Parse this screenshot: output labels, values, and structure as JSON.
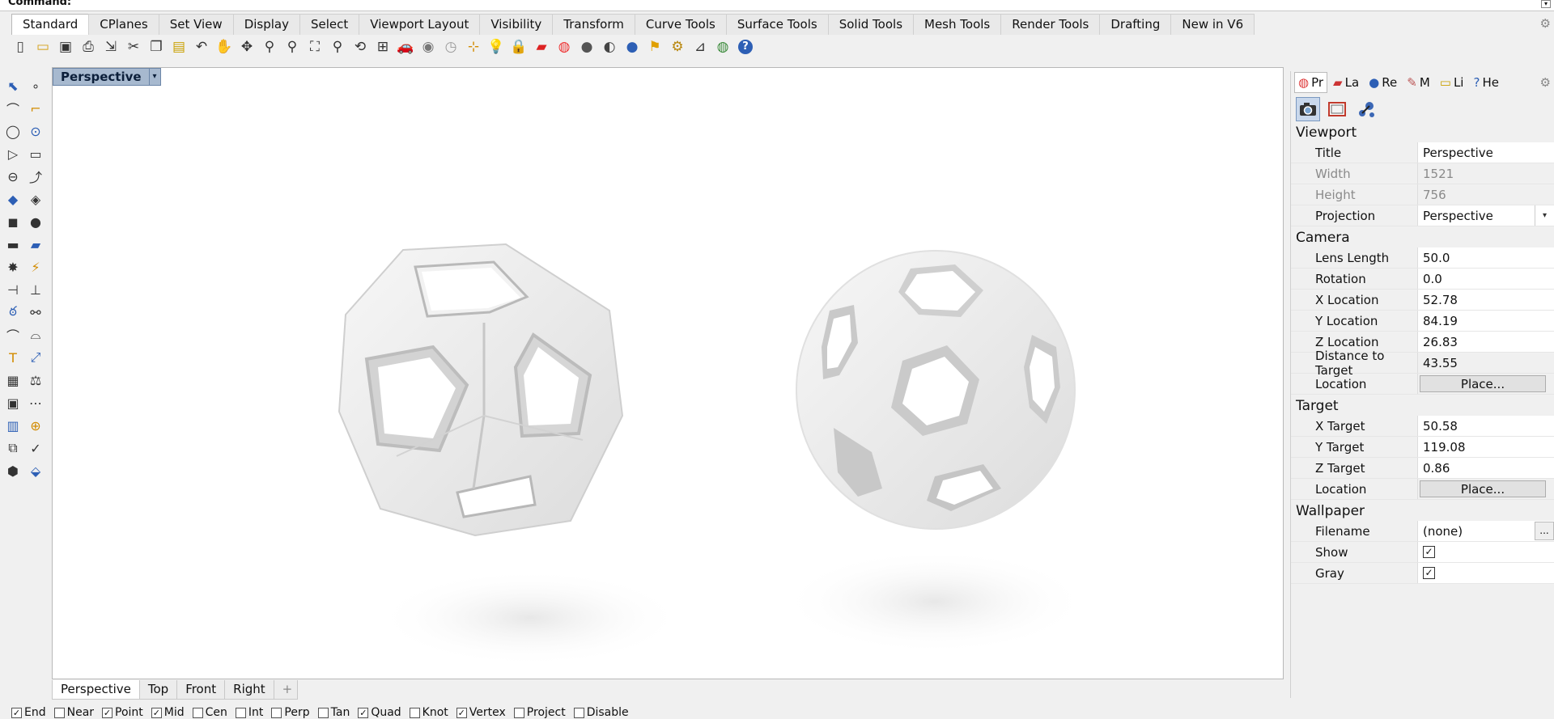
{
  "command": {
    "label": "Command:"
  },
  "tabs": [
    {
      "label": "Standard",
      "active": true
    },
    {
      "label": "CPlanes"
    },
    {
      "label": "Set View"
    },
    {
      "label": "Display"
    },
    {
      "label": "Select"
    },
    {
      "label": "Viewport Layout"
    },
    {
      "label": "Visibility"
    },
    {
      "label": "Transform"
    },
    {
      "label": "Curve Tools"
    },
    {
      "label": "Surface Tools"
    },
    {
      "label": "Solid Tools"
    },
    {
      "label": "Mesh Tools"
    },
    {
      "label": "Render Tools"
    },
    {
      "label": "Drafting"
    },
    {
      "label": "New in V6"
    }
  ],
  "toolbar_icons": [
    "new-icon",
    "open-icon",
    "save-icon",
    "print-icon",
    "import-icon",
    "cut-icon",
    "copy-icon",
    "paste-icon",
    "undo-icon",
    "pan-icon",
    "rotate-view-icon",
    "zoom-icon",
    "zoom-window-icon",
    "zoom-extents-icon",
    "zoom-selected-icon",
    "zoom-target-icon",
    "four-views-icon",
    "car-icon",
    "camera-icon",
    "clock-icon",
    "grid-snap-icon",
    "light-icon",
    "lock-icon",
    "layer-icon",
    "color-wheel-icon",
    "shaded-icon",
    "rendered-icon",
    "render-icon",
    "pointer-flag-icon",
    "settings-gears-icon",
    "dimension-icon",
    "earth-icon",
    "help-icon"
  ],
  "left_tools": [
    [
      "select-icon",
      "point-icon"
    ],
    [
      "polyline-icon",
      "curve-icon"
    ],
    [
      "circle-icon",
      "ellipse-icon"
    ],
    [
      "polygon-icon",
      "rectangle-icon"
    ],
    [
      "arc-icon",
      "fillet-icon"
    ],
    [
      "surface-icon",
      "extrude-icon"
    ],
    [
      "box-icon",
      "boolean-icon"
    ],
    [
      "cylinder-icon",
      "mesh-icon"
    ],
    [
      "explode-icon",
      "trim-icon"
    ],
    [
      "split-icon",
      "join-icon"
    ],
    [
      "group-icon",
      "block-icon"
    ],
    [
      "offset-icon",
      "blend-icon"
    ],
    [
      "text-icon",
      "scale-icon"
    ],
    [
      "array-icon",
      "mirror-icon"
    ],
    [
      "solid-box-icon",
      "dimension-tool-icon"
    ],
    [
      "grid-icon",
      "align-icon"
    ],
    [
      "analyze-icon",
      "check-icon"
    ],
    [
      "material-icon",
      "paint-icon"
    ]
  ],
  "viewport": {
    "title": "Perspective"
  },
  "viewport_tabs": [
    {
      "label": "Perspective",
      "active": true
    },
    {
      "label": "Top"
    },
    {
      "label": "Front"
    },
    {
      "label": "Right"
    },
    {
      "label": "+"
    }
  ],
  "osnap": [
    {
      "label": "End",
      "checked": true
    },
    {
      "label": "Near",
      "checked": false
    },
    {
      "label": "Point",
      "checked": true
    },
    {
      "label": "Mid",
      "checked": true
    },
    {
      "label": "Cen",
      "checked": false
    },
    {
      "label": "Int",
      "checked": false
    },
    {
      "label": "Perp",
      "checked": false
    },
    {
      "label": "Tan",
      "checked": false
    },
    {
      "label": "Quad",
      "checked": true
    },
    {
      "label": "Knot",
      "checked": false
    },
    {
      "label": "Vertex",
      "checked": true
    },
    {
      "label": "Project",
      "checked": false
    },
    {
      "label": "Disable",
      "checked": false
    }
  ],
  "panel_tabs": [
    {
      "label": "Pr",
      "icon": "properties-icon",
      "active": true
    },
    {
      "label": "La",
      "icon": "layers-icon"
    },
    {
      "label": "Re",
      "icon": "render-sphere-icon"
    },
    {
      "label": "M",
      "icon": "materials-icon"
    },
    {
      "label": "Li",
      "icon": "libraries-icon"
    },
    {
      "label": "He",
      "icon": "help-panel-icon"
    }
  ],
  "properties": {
    "viewport_section": "Viewport",
    "title_label": "Title",
    "title_value": "Perspective",
    "width_label": "Width",
    "width_value": "1521",
    "height_label": "Height",
    "height_value": "756",
    "projection_label": "Projection",
    "projection_value": "Perspective",
    "camera_section": "Camera",
    "lens_label": "Lens Length",
    "lens_value": "50.0",
    "rotation_label": "Rotation",
    "rotation_value": "0.0",
    "xloc_label": "X Location",
    "xloc_value": "52.78",
    "yloc_label": "Y Location",
    "yloc_value": "84.19",
    "zloc_label": "Z Location",
    "zloc_value": "26.83",
    "dist_label": "Distance to Target",
    "dist_value": "43.55",
    "cam_location_label": "Location",
    "place_button": "Place...",
    "target_section": "Target",
    "xt_label": "X Target",
    "xt_value": "50.58",
    "yt_label": "Y Target",
    "yt_value": "119.08",
    "zt_label": "Z Target",
    "zt_value": "0.86",
    "tgt_location_label": "Location",
    "wallpaper_section": "Wallpaper",
    "filename_label": "Filename",
    "filename_value": "(none)",
    "browse_button": "...",
    "show_label": "Show",
    "show_checked": true,
    "gray_label": "Gray",
    "gray_checked": true
  },
  "colors": {
    "accent": "#a7b9cf",
    "viewport_bg": "#ffffff",
    "panel_bg": "#f0f0f0"
  }
}
